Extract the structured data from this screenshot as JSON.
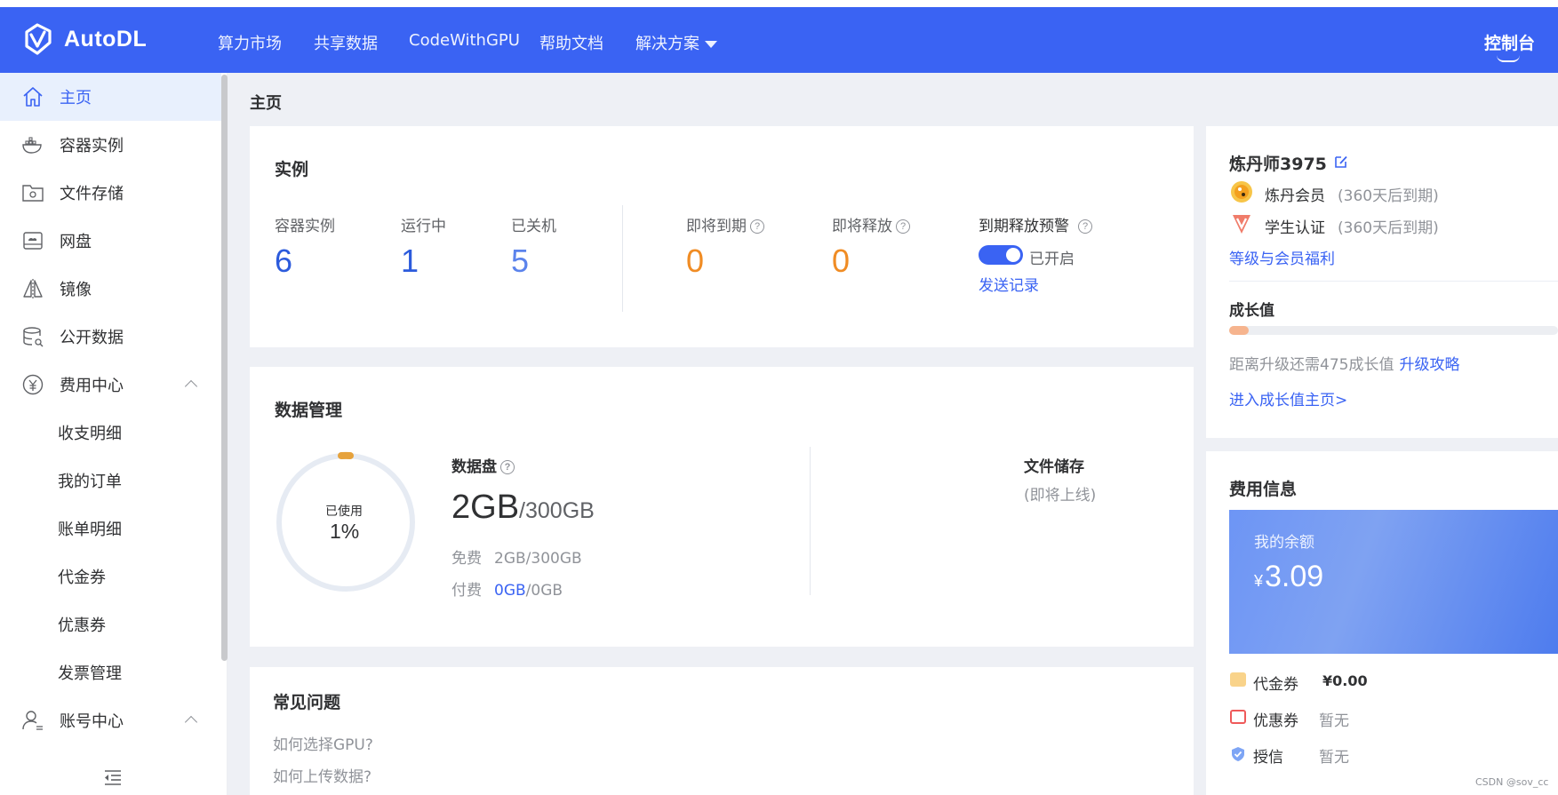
{
  "brand": {
    "name": "AutoDL",
    "color": "#3a63f3"
  },
  "navbar": {
    "items": [
      "算力市场",
      "共享数据",
      "CodeWithGPU",
      "帮助文档",
      "解决方案"
    ],
    "console_label": "控制台"
  },
  "sidebar": {
    "items": [
      {
        "label": "主页",
        "icon": "home-icon"
      },
      {
        "label": "容器实例",
        "icon": "docker-icon"
      },
      {
        "label": "文件存储",
        "icon": "folder-gear-icon"
      },
      {
        "label": "网盘",
        "icon": "cloud-drive-icon"
      },
      {
        "label": "镜像",
        "icon": "mirror-icon"
      },
      {
        "label": "公开数据",
        "icon": "database-icon"
      },
      {
        "label": "费用中心",
        "icon": "yuan-icon"
      },
      {
        "label": "账号中心",
        "icon": "user-icon"
      }
    ],
    "fee_sub": [
      "收支明细",
      "我的订单",
      "账单明细",
      "代金券",
      "优惠券",
      "发票管理"
    ]
  },
  "page": {
    "title": "主页"
  },
  "instances": {
    "title": "实例",
    "container_label": "容器实例",
    "container_value": "6",
    "running_label": "运行中",
    "running_value": "1",
    "stopped_label": "已关机",
    "stopped_value": "5",
    "expiring_label": "即将到期",
    "expiring_value": "0",
    "releasing_label": "即将释放",
    "releasing_value": "0",
    "alert_label": "到期释放预警",
    "alert_status": "已开启",
    "send_record": "发送记录"
  },
  "data_mgmt": {
    "title": "数据管理",
    "used_label": "已使用",
    "used_percent": "1%",
    "disk_label": "数据盘",
    "disk_used": "2GB",
    "disk_total": "/300GB",
    "free_label": "免费",
    "free_value": "2GB/300GB",
    "paid_label": "付费",
    "paid_used": "0GB",
    "paid_total": "/0GB",
    "storage_label": "文件储存",
    "storage_status": "(即将上线)"
  },
  "faq": {
    "title": "常见问题",
    "items": [
      "如何选择GPU?",
      "如何上传数据?"
    ]
  },
  "profile": {
    "username": "炼丹师3975",
    "member_label": "炼丹会员",
    "member_expiry": "(360天后到期)",
    "student_label": "学生认证",
    "student_expiry": "(360天后到期)",
    "benefits_link": "等级与会员福利",
    "growth_title": "成长值",
    "growth_progress_percent": 6,
    "growth_hint": "距离升级还需475成长值",
    "growth_guide": "升级攻略",
    "growth_home": "进入成长值主页>"
  },
  "fees": {
    "title": "费用信息",
    "balance_label": "我的余额",
    "currency": "¥",
    "balance": "3.09",
    "voucher_label": "代金券",
    "voucher_value": "¥0.00",
    "coupon_label": "优惠券",
    "coupon_value": "暂无",
    "credit_label": "授信",
    "credit_value": "暂无"
  },
  "watermark": "CSDN @sov_cc"
}
